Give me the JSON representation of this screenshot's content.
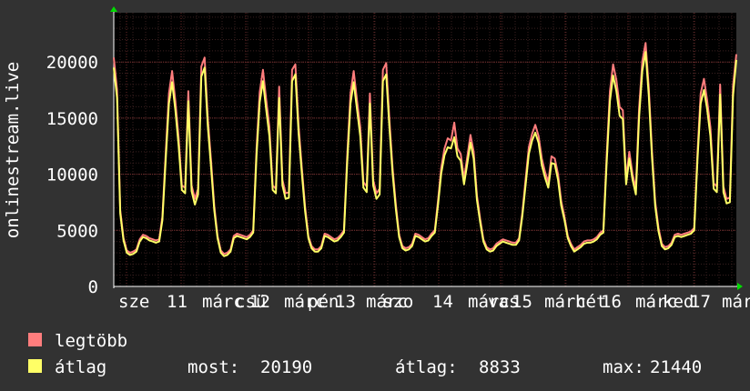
{
  "chart_data": {
    "type": "line",
    "ylabel": "onlinestream.live",
    "ylim": [
      0,
      24500
    ],
    "yticks": [
      0,
      5000,
      10000,
      15000,
      20000
    ],
    "x_tick_labels": [
      "sze",
      "11",
      "márc",
      "csü",
      "12",
      "márc",
      "pén",
      "13",
      "márc",
      "szo",
      "14",
      "márc",
      "vas",
      "15",
      "márc",
      "hét",
      "16",
      "márc",
      "ked",
      "17",
      "márc"
    ],
    "grid": true,
    "background": "#000000",
    "series": [
      {
        "name": "legtöbb",
        "color": "#ff7d7d",
        "values": [
          20400,
          17500,
          6800,
          4300,
          3200,
          3000,
          3100,
          3300,
          4200,
          4600,
          4500,
          4300,
          4200,
          4100,
          4200,
          6200,
          11800,
          17200,
          19200,
          16500,
          13200,
          9000,
          8800,
          17400,
          9000,
          7800,
          8700,
          19600,
          20400,
          15000,
          11200,
          7200,
          4500,
          3200,
          2900,
          3000,
          3300,
          4500,
          4700,
          4600,
          4500,
          4400,
          4600,
          5000,
          12200,
          17300,
          19300,
          16700,
          14200,
          9000,
          8700,
          17800,
          9500,
          8300,
          8400,
          19300,
          19800,
          14300,
          10600,
          7100,
          4500,
          3600,
          3300,
          3300,
          3600,
          4700,
          4600,
          4400,
          4200,
          4300,
          4600,
          5000,
          11700,
          17200,
          19200,
          16600,
          14200,
          9300,
          8900,
          17200,
          9500,
          8300,
          8700,
          19300,
          19900,
          14900,
          10500,
          7300,
          4600,
          3600,
          3400,
          3500,
          3800,
          4700,
          4600,
          4400,
          4200,
          4300,
          4700,
          5000,
          7700,
          10600,
          12300,
          13200,
          13000,
          14600,
          12300,
          11800,
          9600,
          11500,
          13500,
          12000,
          8100,
          6000,
          4200,
          3500,
          3300,
          3400,
          3800,
          4000,
          4200,
          4100,
          4000,
          3900,
          3900,
          4300,
          6600,
          9500,
          12400,
          13600,
          14400,
          13400,
          11400,
          10200,
          9300,
          11600,
          11400,
          10000,
          7600,
          6200,
          4500,
          3800,
          3300,
          3500,
          3700,
          4000,
          4100,
          4100,
          4200,
          4400,
          4800,
          5000,
          11600,
          17400,
          19800,
          18400,
          16000,
          15700,
          9600,
          12000,
          10000,
          8700,
          15800,
          20100,
          21700,
          17700,
          12000,
          7500,
          5200,
          3800,
          3500,
          3600,
          3900,
          4600,
          4700,
          4600,
          4700,
          4800,
          4900,
          5200,
          11900,
          17200,
          18500,
          16600,
          14200,
          9200,
          8900,
          18000,
          8900,
          7800,
          7900,
          17900,
          20700
        ]
      },
      {
        "name": "átlag",
        "color": "#ffff66",
        "values": [
          19500,
          16800,
          6500,
          4100,
          3000,
          2800,
          2900,
          3100,
          4000,
          4400,
          4300,
          4100,
          4000,
          3900,
          4000,
          5900,
          11200,
          16300,
          18200,
          15700,
          12500,
          8600,
          8300,
          16500,
          8500,
          7300,
          8200,
          18700,
          19500,
          14300,
          10600,
          6800,
          4300,
          3000,
          2700,
          2800,
          3100,
          4300,
          4500,
          4400,
          4300,
          4200,
          4400,
          4800,
          11600,
          16400,
          18300,
          15800,
          13400,
          8600,
          8300,
          16800,
          9000,
          7800,
          7900,
          18300,
          18900,
          13600,
          10100,
          6700,
          4300,
          3400,
          3100,
          3100,
          3400,
          4500,
          4400,
          4200,
          4000,
          4100,
          4400,
          4800,
          11100,
          16300,
          18200,
          15800,
          13400,
          8800,
          8400,
          16300,
          9000,
          7800,
          8200,
          18300,
          18900,
          14200,
          10000,
          6900,
          4400,
          3400,
          3200,
          3300,
          3600,
          4500,
          4400,
          4200,
          4000,
          4100,
          4500,
          4800,
          7300,
          10100,
          11700,
          12400,
          12300,
          13300,
          11600,
          11200,
          9100,
          10900,
          12800,
          11400,
          7700,
          5700,
          4000,
          3300,
          3100,
          3200,
          3600,
          3800,
          4000,
          3900,
          3800,
          3700,
          3700,
          4100,
          6300,
          9000,
          11800,
          13000,
          13700,
          12800,
          10800,
          9700,
          8800,
          11000,
          10900,
          9500,
          7200,
          5900,
          4300,
          3600,
          3100,
          3300,
          3500,
          3800,
          3900,
          3900,
          4000,
          4200,
          4600,
          4800,
          11000,
          16500,
          18800,
          17400,
          15200,
          14900,
          9100,
          11400,
          9500,
          8200,
          15000,
          19200,
          20900,
          17000,
          11400,
          7100,
          4900,
          3600,
          3300,
          3400,
          3700,
          4400,
          4500,
          4400,
          4500,
          4600,
          4700,
          5000,
          11300,
          16300,
          17500,
          15800,
          13400,
          8700,
          8400,
          17100,
          8400,
          7400,
          7500,
          17000,
          20190
        ]
      }
    ]
  },
  "legend": [
    {
      "label": "legtöbb",
      "color": "#ff7d7d"
    },
    {
      "label": "átlag",
      "color": "#ffff66"
    }
  ],
  "stats": {
    "most_label": "most:",
    "most_value": "20190",
    "atlag_label": "átlag:",
    "atlag_value": "8833",
    "max_label": "max:",
    "max_value": "21440"
  }
}
